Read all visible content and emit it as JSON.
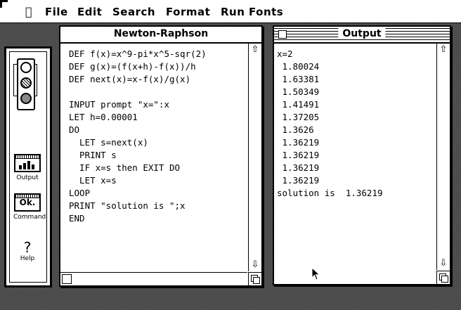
{
  "menubar": {
    "items": [
      "File",
      "Edit",
      "Search",
      "Format",
      "Run",
      "Fonts"
    ]
  },
  "editor": {
    "title": "Newton-Raphson",
    "lines": [
      "DEF f(x)=x^9-pi*x^5-sqr(2)",
      "DEF g(x)=(f(x+h)-f(x))/h",
      "DEF next(x)=x-f(x)/g(x)",
      "",
      "INPUT prompt \"x=\":x",
      "LET h=0.00001",
      "DO",
      "  LET s=next(x)",
      "  PRINT s",
      "  IF x=s then EXIT DO",
      "  LET x=s",
      "LOOP",
      "PRINT \"solution is \";x",
      "END"
    ]
  },
  "output": {
    "title": "Output",
    "lines": [
      "x=2",
      " 1.80024",
      " 1.63381",
      " 1.50349",
      " 1.41491",
      " 1.37205",
      " 1.3626",
      " 1.36219",
      " 1.36219",
      " 1.36219",
      " 1.36219",
      "solution is  1.36219"
    ]
  },
  "palette": {
    "output_label": "Output",
    "ok_glyph": "Ok.",
    "command_label": "Command",
    "help_glyph": "?",
    "help_label": "Help"
  },
  "icons": {
    "apple": "apple-icon",
    "scroll_up": "scroll-up-arrow-icon",
    "scroll_down": "scroll-down-arrow-icon",
    "grow_box": "grow-box-icon",
    "close_box": "close-box-icon",
    "traffic_light": "traffic-light-icon",
    "output_chart": "bar-chart-icon",
    "help": "question-mark-icon",
    "cursor": "mouse-pointer-icon"
  }
}
